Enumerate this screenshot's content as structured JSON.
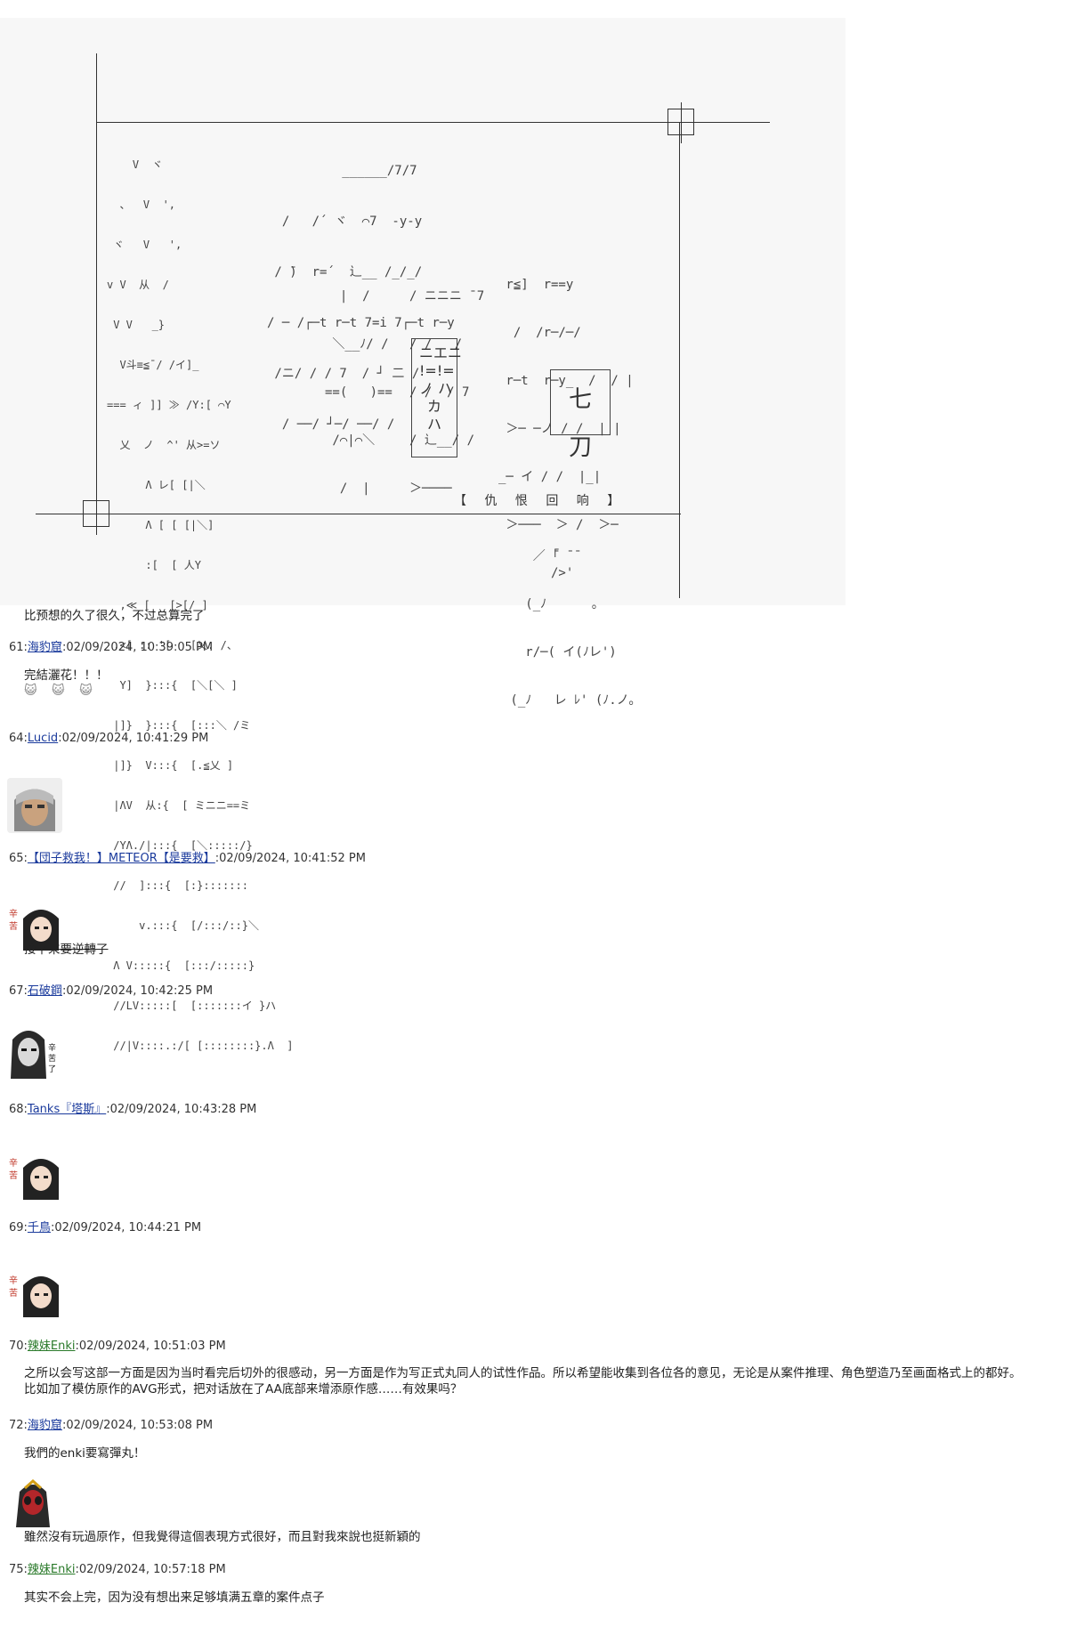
{
  "aa_art": {
    "title_art_lines": [
      "          ______/7/7",
      "  /   /´ ヾ  ⌒7  -y-y",
      " / ̄)  r=´  辶__ /_/_/",
      "/ ─ /┌─t r─t 7=i 7┌─t r─y",
      " /ニ/ / / 7  / ┘ 二 /",
      "  / ──/ ┘─/ ──/ /"
    ],
    "tree_art_lines": [
      "    V  ヾ",
      "  、  V  ',",
      " ヾ   V   ',",
      "v V  从  /",
      " V V   _}",
      "  V斗≡≦¯/ /イ]_",
      "=== ィ ]] ≫ /Y:[ ⌒Y",
      "  乂  ノ  ^' 从>=ソ",
      "      Λ レ[ [|＼",
      "      Λ [ [ [|＼]",
      "      :[  [ 人Y",
      "  ,≪ [   [>[/ ]",
      " ,<[ :: '[   [乂. /、",
      "  Y]  }:::{  [＼[＼ ]",
      " |]}  }:::{  [:::＼ /ミ",
      " |]}  V:::{  [.≦乂 ]",
      " |ΛV  从:{  [ ミニニ==ミ",
      " /YΛ./|:::{  [＼:::::/}",
      " //  ]:::{  [:}:::::::",
      "     v.:::{  [/:::/::}＼",
      " Λ V:::::{  [:::/:::::}",
      " //LV:::::[  [:::::::イ }ハ",
      " //|V::::.:/[ [::::::::}.Λ  ]"
    ],
    "sun_art_lines": [
      "  |  /",
      " ＼__ﾉ/ /",
      "==(   )==",
      " /⌒|⌒＼",
      "  /  |"
    ],
    "box1_text": "ニエニ\n!=!=\nノ ハ\nカ\nハ",
    "box2_text": "七刀",
    "caption": "【 仇 恨 回 响 】",
    "fin_art_lines": [
      "    ／ ̄｢ ̄ ̄",
      "   (_ﾉ      。",
      "   r/─( イ(ﾉレ')",
      " (_ﾉ   レ ﾚ' (ﾉ.ノ。"
    ],
    "right_art_lines": [
      " r≦]  r==y",
      "  /  /r─/─/",
      " r─t  r─y_  /  / |",
      " ＞─ ─ノ / /  | |",
      "_─ イ / /  |_|",
      " ＞───  ＞ /  ＞─",
      "       />'"
    ],
    "mid_art_lines": [
      "/ ニニニ ̄ 7",
      "/ /   /",
      "/ /  / 7",
      "/ 辶__/ /",
      "＞────"
    ]
  },
  "posts": [
    {
      "body": "比预想的久了很久，不过总算完了"
    },
    {
      "number": "61:",
      "name": "海豹窟",
      "time": ":02/09/2024, 10:39:05 PM",
      "body": "完結灑花！！！",
      "emoji": "😺 😺 😺"
    },
    {
      "number": "64:",
      "name": "Lucid",
      "time": ":02/09/2024, 10:41:29 PM"
    },
    {
      "number": "65:",
      "name": "【団子救我！】METEOR【是要救】",
      "time": ":02/09/2024, 10:41:52 PM",
      "body": "接下來要逆轉了"
    },
    {
      "number": "67:",
      "name": "石破鋼",
      "time": ":02/09/2024, 10:42:25 PM"
    },
    {
      "number": "68:",
      "name": "Tanks『塔斯』",
      "time": ":02/09/2024, 10:43:28 PM"
    },
    {
      "number": "69:",
      "name": "千鳥",
      "time": ":02/09/2024, 10:44:21 PM"
    },
    {
      "number": "70:",
      "name": "辣妹Enki",
      "time": ":02/09/2024, 10:51:03 PM",
      "body": "之所以会写这部一方面是因为当时看完后切外的很感动，另一方面是作为写正式丸同人的试性作品。所以希望能收集到各位各的意见，无论是从案件推理、角色塑造乃至画面格式上的都好。\n比如加了模仿原作的AVG形式，把对话放在了AA底部来增添原作感……有效果吗？"
    },
    {
      "number": "72:",
      "name": "海豹窟",
      "time": ":02/09/2024, 10:53:08 PM",
      "body": "我們的enki要寫彈丸！"
    },
    {
      "body": "雖然沒有玩過原作，但我覺得這個表現方式很好，而且對我來說也挺新穎的"
    },
    {
      "number": "75:",
      "name": "辣妹Enki",
      "time": ":02/09/2024, 10:57:18 PM",
      "body": "其实不会上完，因为没有想出来足够填满五章的案件点子"
    }
  ],
  "colors": {
    "link": "#1a3a9c",
    "link_green": "#2a7a2a",
    "text": "#222222"
  }
}
